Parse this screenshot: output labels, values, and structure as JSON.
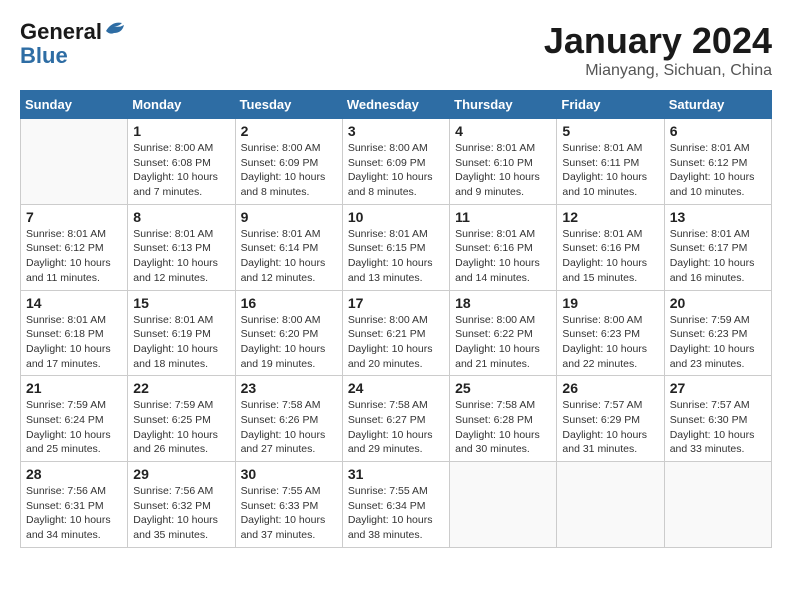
{
  "header": {
    "logo_line1": "General",
    "logo_line2": "Blue",
    "month": "January 2024",
    "location": "Mianyang, Sichuan, China"
  },
  "weekdays": [
    "Sunday",
    "Monday",
    "Tuesday",
    "Wednesday",
    "Thursday",
    "Friday",
    "Saturday"
  ],
  "weeks": [
    [
      {
        "day": "",
        "info": ""
      },
      {
        "day": "1",
        "info": "Sunrise: 8:00 AM\nSunset: 6:08 PM\nDaylight: 10 hours\nand 7 minutes."
      },
      {
        "day": "2",
        "info": "Sunrise: 8:00 AM\nSunset: 6:09 PM\nDaylight: 10 hours\nand 8 minutes."
      },
      {
        "day": "3",
        "info": "Sunrise: 8:00 AM\nSunset: 6:09 PM\nDaylight: 10 hours\nand 8 minutes."
      },
      {
        "day": "4",
        "info": "Sunrise: 8:01 AM\nSunset: 6:10 PM\nDaylight: 10 hours\nand 9 minutes."
      },
      {
        "day": "5",
        "info": "Sunrise: 8:01 AM\nSunset: 6:11 PM\nDaylight: 10 hours\nand 10 minutes."
      },
      {
        "day": "6",
        "info": "Sunrise: 8:01 AM\nSunset: 6:12 PM\nDaylight: 10 hours\nand 10 minutes."
      }
    ],
    [
      {
        "day": "7",
        "info": "Sunrise: 8:01 AM\nSunset: 6:12 PM\nDaylight: 10 hours\nand 11 minutes."
      },
      {
        "day": "8",
        "info": "Sunrise: 8:01 AM\nSunset: 6:13 PM\nDaylight: 10 hours\nand 12 minutes."
      },
      {
        "day": "9",
        "info": "Sunrise: 8:01 AM\nSunset: 6:14 PM\nDaylight: 10 hours\nand 12 minutes."
      },
      {
        "day": "10",
        "info": "Sunrise: 8:01 AM\nSunset: 6:15 PM\nDaylight: 10 hours\nand 13 minutes."
      },
      {
        "day": "11",
        "info": "Sunrise: 8:01 AM\nSunset: 6:16 PM\nDaylight: 10 hours\nand 14 minutes."
      },
      {
        "day": "12",
        "info": "Sunrise: 8:01 AM\nSunset: 6:16 PM\nDaylight: 10 hours\nand 15 minutes."
      },
      {
        "day": "13",
        "info": "Sunrise: 8:01 AM\nSunset: 6:17 PM\nDaylight: 10 hours\nand 16 minutes."
      }
    ],
    [
      {
        "day": "14",
        "info": "Sunrise: 8:01 AM\nSunset: 6:18 PM\nDaylight: 10 hours\nand 17 minutes."
      },
      {
        "day": "15",
        "info": "Sunrise: 8:01 AM\nSunset: 6:19 PM\nDaylight: 10 hours\nand 18 minutes."
      },
      {
        "day": "16",
        "info": "Sunrise: 8:00 AM\nSunset: 6:20 PM\nDaylight: 10 hours\nand 19 minutes."
      },
      {
        "day": "17",
        "info": "Sunrise: 8:00 AM\nSunset: 6:21 PM\nDaylight: 10 hours\nand 20 minutes."
      },
      {
        "day": "18",
        "info": "Sunrise: 8:00 AM\nSunset: 6:22 PM\nDaylight: 10 hours\nand 21 minutes."
      },
      {
        "day": "19",
        "info": "Sunrise: 8:00 AM\nSunset: 6:23 PM\nDaylight: 10 hours\nand 22 minutes."
      },
      {
        "day": "20",
        "info": "Sunrise: 7:59 AM\nSunset: 6:23 PM\nDaylight: 10 hours\nand 23 minutes."
      }
    ],
    [
      {
        "day": "21",
        "info": "Sunrise: 7:59 AM\nSunset: 6:24 PM\nDaylight: 10 hours\nand 25 minutes."
      },
      {
        "day": "22",
        "info": "Sunrise: 7:59 AM\nSunset: 6:25 PM\nDaylight: 10 hours\nand 26 minutes."
      },
      {
        "day": "23",
        "info": "Sunrise: 7:58 AM\nSunset: 6:26 PM\nDaylight: 10 hours\nand 27 minutes."
      },
      {
        "day": "24",
        "info": "Sunrise: 7:58 AM\nSunset: 6:27 PM\nDaylight: 10 hours\nand 29 minutes."
      },
      {
        "day": "25",
        "info": "Sunrise: 7:58 AM\nSunset: 6:28 PM\nDaylight: 10 hours\nand 30 minutes."
      },
      {
        "day": "26",
        "info": "Sunrise: 7:57 AM\nSunset: 6:29 PM\nDaylight: 10 hours\nand 31 minutes."
      },
      {
        "day": "27",
        "info": "Sunrise: 7:57 AM\nSunset: 6:30 PM\nDaylight: 10 hours\nand 33 minutes."
      }
    ],
    [
      {
        "day": "28",
        "info": "Sunrise: 7:56 AM\nSunset: 6:31 PM\nDaylight: 10 hours\nand 34 minutes."
      },
      {
        "day": "29",
        "info": "Sunrise: 7:56 AM\nSunset: 6:32 PM\nDaylight: 10 hours\nand 35 minutes."
      },
      {
        "day": "30",
        "info": "Sunrise: 7:55 AM\nSunset: 6:33 PM\nDaylight: 10 hours\nand 37 minutes."
      },
      {
        "day": "31",
        "info": "Sunrise: 7:55 AM\nSunset: 6:34 PM\nDaylight: 10 hours\nand 38 minutes."
      },
      {
        "day": "",
        "info": ""
      },
      {
        "day": "",
        "info": ""
      },
      {
        "day": "",
        "info": ""
      }
    ]
  ]
}
